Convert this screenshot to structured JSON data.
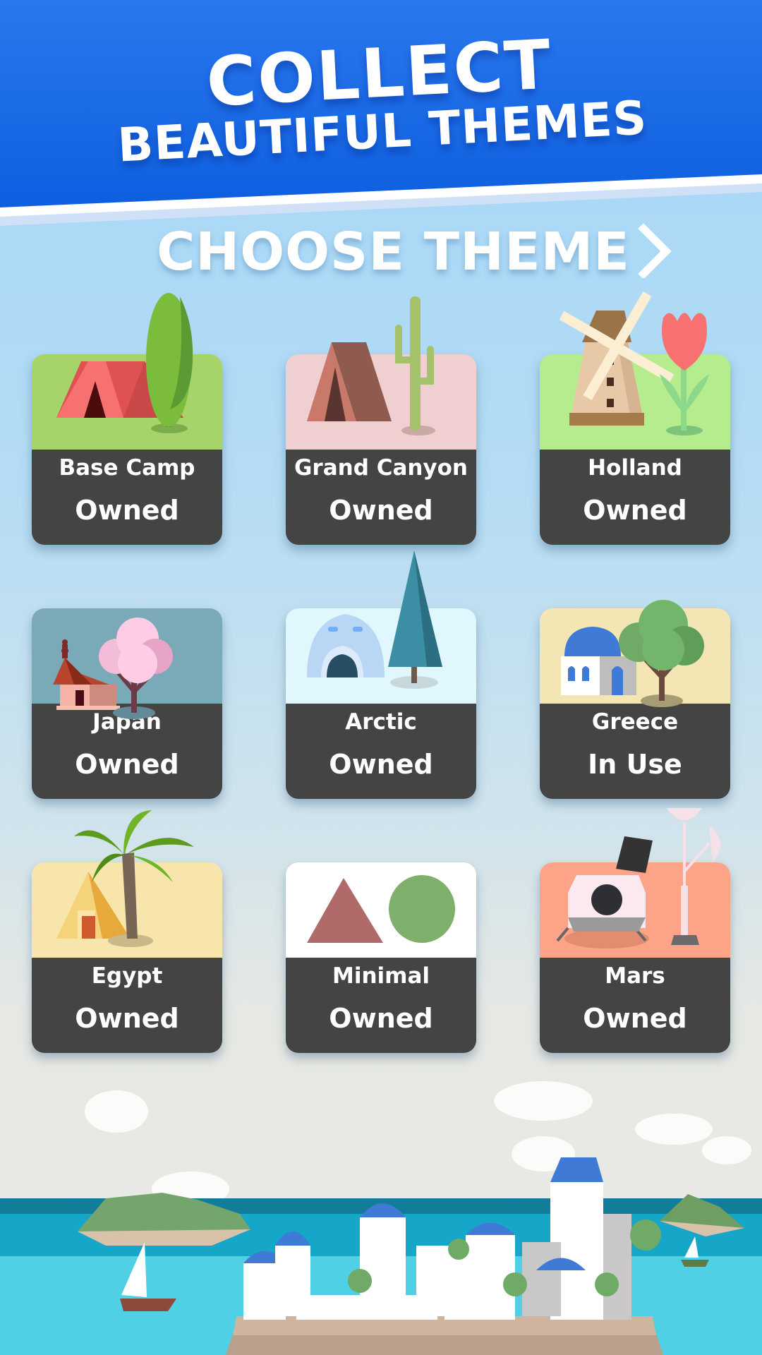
{
  "banner": {
    "headline_line1": "COLLECT",
    "headline_line2": "BEAUTIFUL THEMES",
    "color": "#1f6fe8"
  },
  "theme_picker": {
    "label": "CHOOSE THEME",
    "arrow_icon": "chevron-right-icon"
  },
  "themes": [
    {
      "name": "Base Camp",
      "status": "Owned",
      "bg": "#a7d46a",
      "icon": "tent-tree-icon"
    },
    {
      "name": "Grand Canyon",
      "status": "Owned",
      "bg": "#efcfcf",
      "icon": "tent-cactus-icon"
    },
    {
      "name": "Holland",
      "status": "Owned",
      "bg": "#b5ec8e",
      "icon": "windmill-tulip-icon"
    },
    {
      "name": "Japan",
      "status": "Owned",
      "bg": "#7aaab8",
      "icon": "pagoda-cherry-tree-icon"
    },
    {
      "name": "Arctic",
      "status": "Owned",
      "bg": "#e0f7fd",
      "icon": "igloo-pine-tree-icon"
    },
    {
      "name": "Greece",
      "status": "In Use",
      "bg": "#f3e6b4",
      "icon": "chapel-tree-icon"
    },
    {
      "name": "Egypt",
      "status": "Owned",
      "bg": "#f7e5ac",
      "icon": "pyramid-palm-icon"
    },
    {
      "name": "Minimal",
      "status": "Owned",
      "bg": "#ffffff",
      "icon": "triangle-circle-icon"
    },
    {
      "name": "Mars",
      "status": "Owned",
      "bg": "#fda488",
      "icon": "lander-antenna-icon"
    }
  ]
}
